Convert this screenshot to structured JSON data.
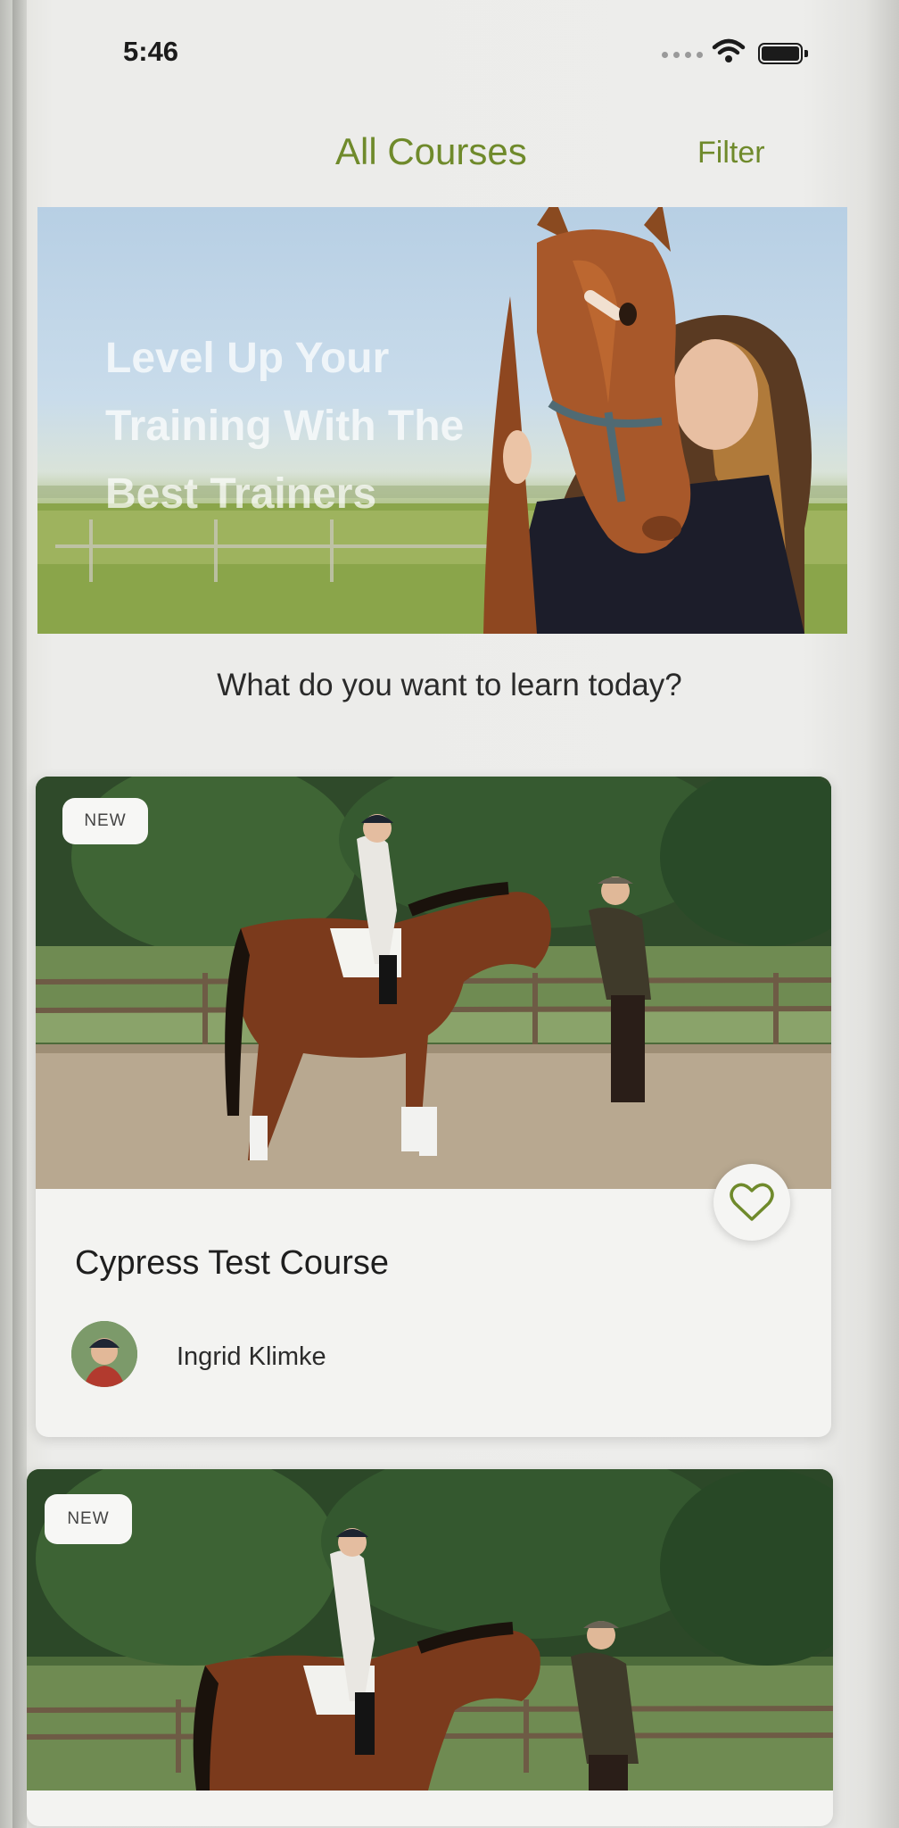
{
  "status_bar": {
    "time": "5:46"
  },
  "header": {
    "title": "All Courses",
    "filter_label": "Filter"
  },
  "hero": {
    "line1": "Level Up Your",
    "line2": "Training With The",
    "line3": "Best Trainers"
  },
  "prompt": "What do you want to learn today?",
  "courses": [
    {
      "badge": "NEW",
      "title": "Cypress Test Course",
      "trainer": "Ingrid Klimke",
      "favorite_icon": "heart-outline-icon"
    },
    {
      "badge": "NEW"
    }
  ],
  "colors": {
    "accent": "#6f8a2b"
  }
}
